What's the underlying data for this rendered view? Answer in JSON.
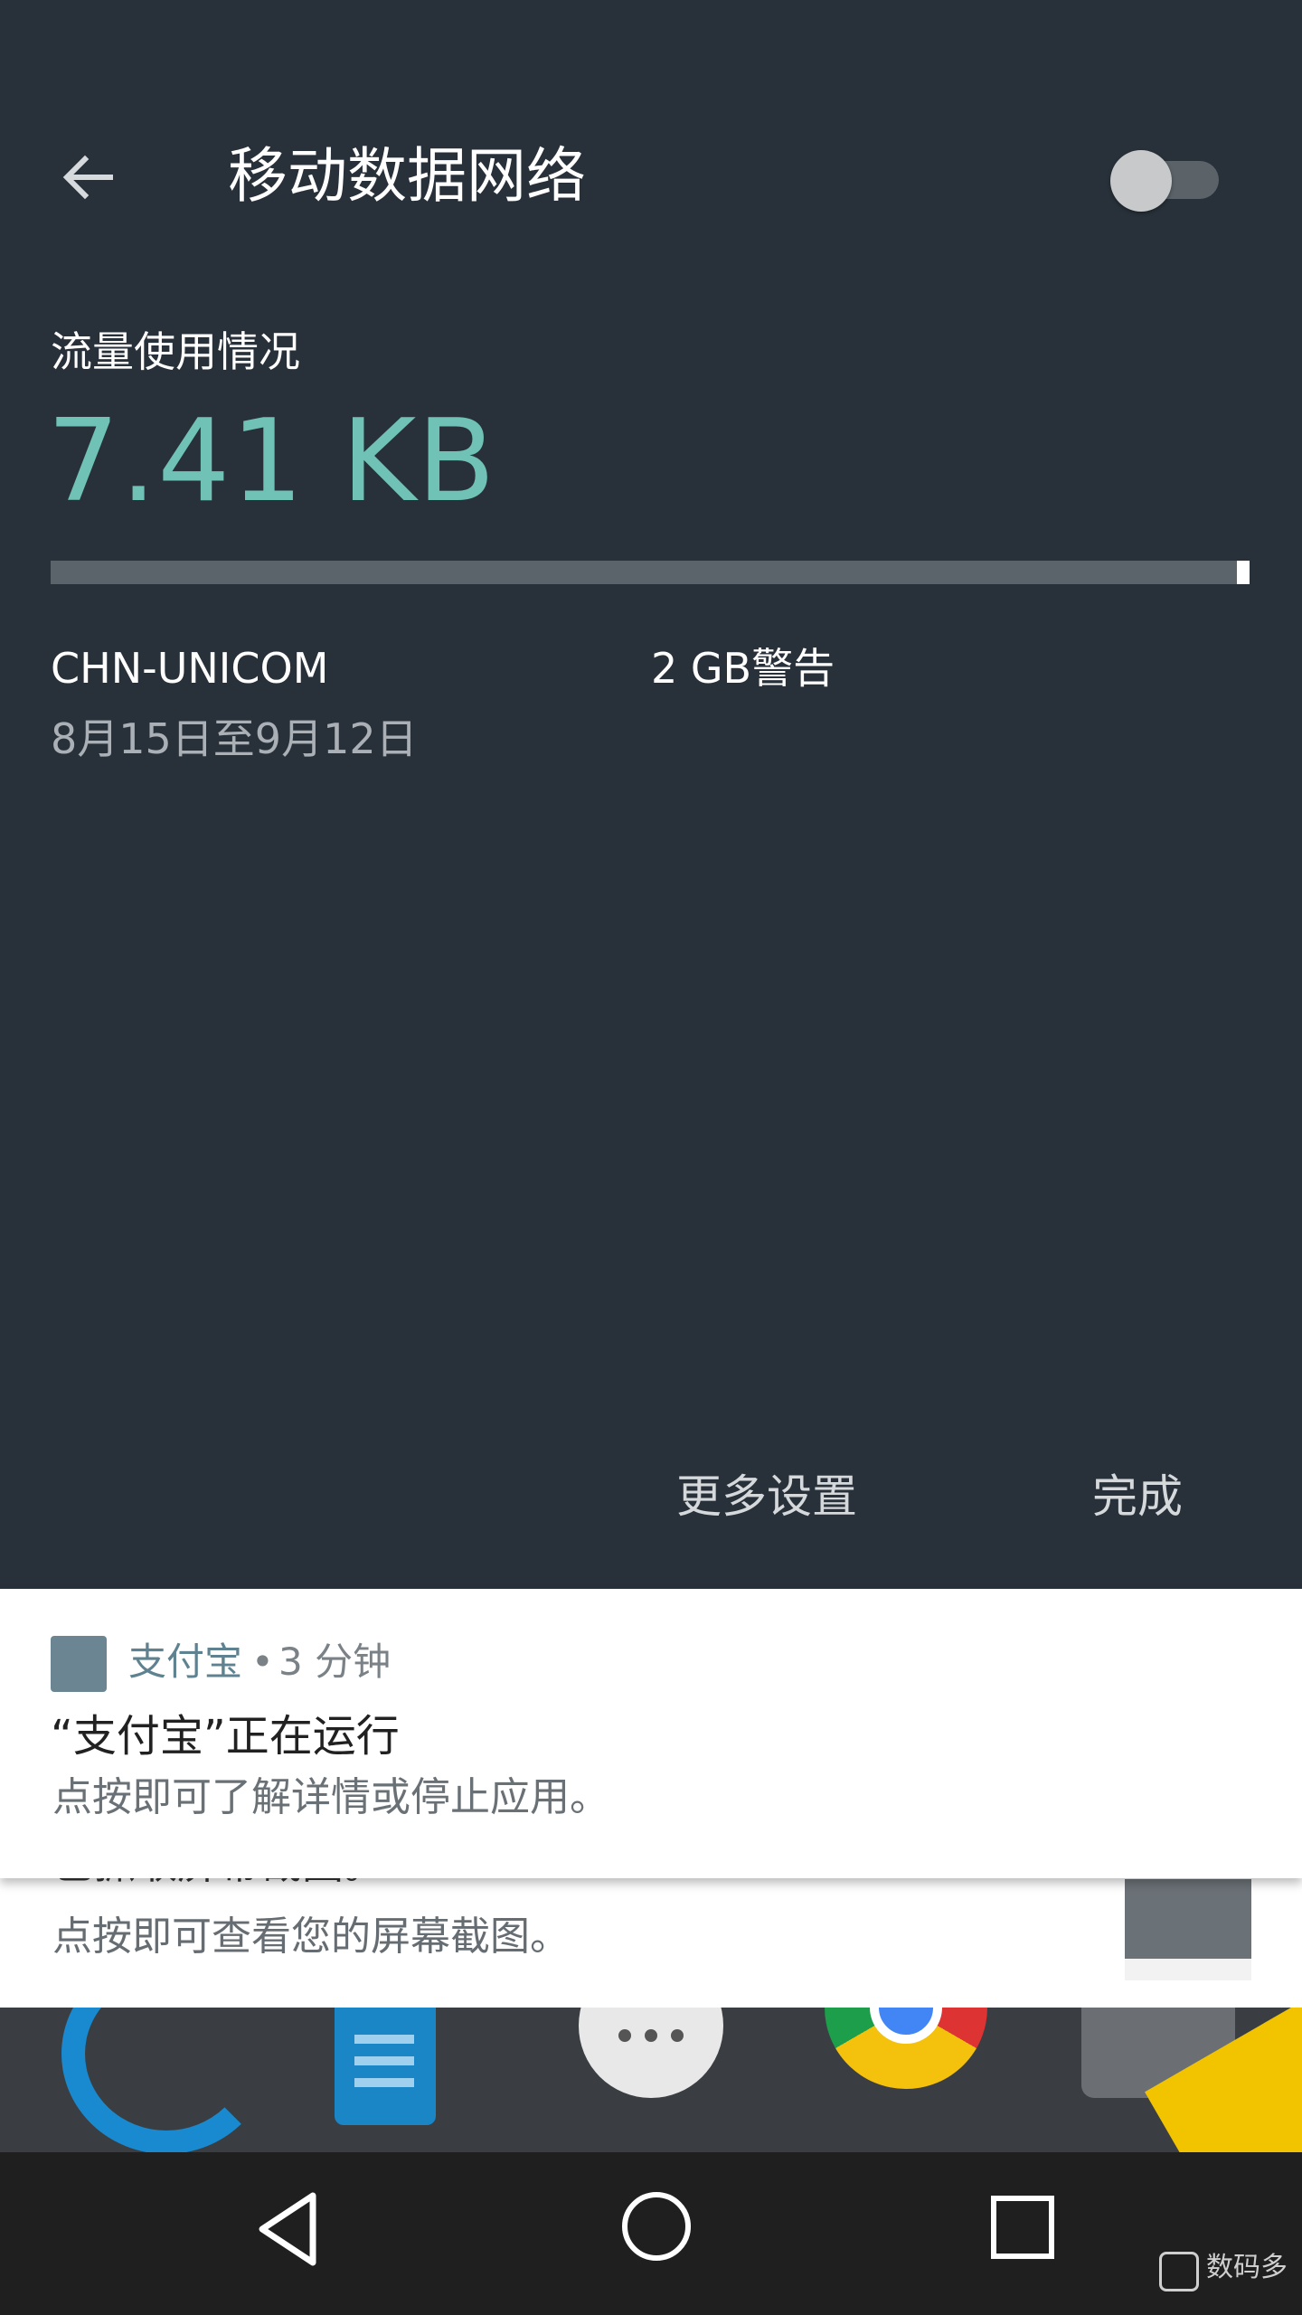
{
  "header": {
    "title": "移动数据网络",
    "toggle_state": "off"
  },
  "usage": {
    "label": "流量使用情况",
    "value": "7.41 KB",
    "bar_fill_fraction": 0.0
  },
  "plan": {
    "carrier": "CHN-UNICOM",
    "warning": "2 GB警告",
    "period": "8月15日至9月12日"
  },
  "actions": {
    "more_settings": "更多设置",
    "done": "完成"
  },
  "notification_front": {
    "app_name": "支付宝",
    "separator": "•",
    "time": "3 分钟",
    "title": "“支付宝”正在运行",
    "text": "点按即可了解详情或停止应用。"
  },
  "notification_back": {
    "cut_title": "已抓取屏幕截图。",
    "text": "点按即可查看您的屏幕截图。"
  },
  "watermark": {
    "text": "数码多"
  },
  "colors": {
    "accent": "#6fc2b5",
    "background": "#28313a",
    "app_icon": "#6b8692"
  },
  "icons": {
    "back": "arrow-left-icon",
    "nav_back": "triangle-back-icon",
    "nav_home": "circle-home-icon",
    "nav_recent": "square-recent-icon"
  }
}
